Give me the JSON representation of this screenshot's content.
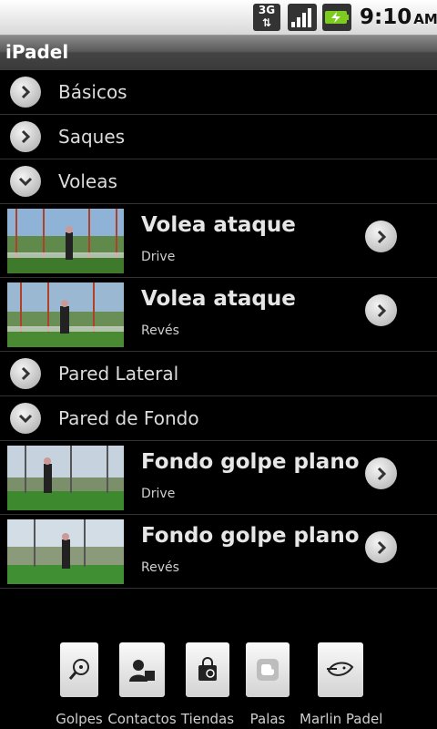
{
  "status_bar": {
    "network": "3G",
    "time": "9:10",
    "ampm": "AM"
  },
  "app": {
    "title": "iPadel"
  },
  "sections": [
    {
      "label": "Básicos",
      "expanded": false
    },
    {
      "label": "Saques",
      "expanded": false
    },
    {
      "label": "Voleas",
      "expanded": true,
      "items": [
        {
          "title": "Volea ataque",
          "subtitle": "Drive"
        },
        {
          "title": "Volea ataque",
          "subtitle": "Revés"
        }
      ]
    },
    {
      "label": "Pared Lateral",
      "expanded": false
    },
    {
      "label": "Pared de Fondo",
      "expanded": true,
      "items": [
        {
          "title": "Fondo golpe plano",
          "subtitle": "Drive"
        },
        {
          "title": "Fondo golpe plano",
          "subtitle": "Revés"
        }
      ]
    }
  ],
  "tabs": [
    {
      "label": "Golpes",
      "icon": "racket-icon"
    },
    {
      "label": "Contactos",
      "icon": "contacts-icon"
    },
    {
      "label": "Tiendas",
      "icon": "shopping-bag-icon"
    },
    {
      "label": "Palas",
      "icon": "blogger-icon"
    },
    {
      "label": "Marlin Padel",
      "icon": "marlin-icon"
    }
  ]
}
